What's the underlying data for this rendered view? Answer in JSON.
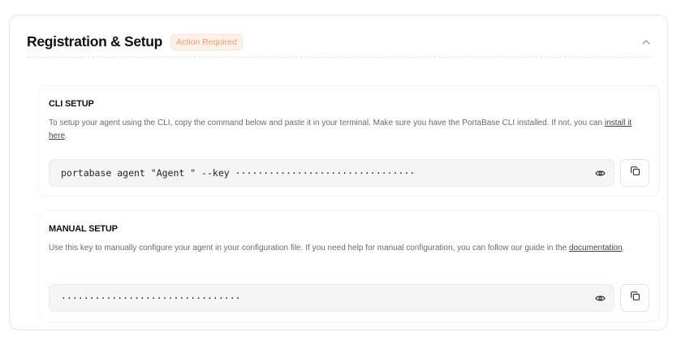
{
  "header": {
    "title": "Registration & Setup",
    "badge": "Action Required"
  },
  "cli": {
    "title": "CLI SETUP",
    "desc_before": "To setup your agent using the CLI, copy the command below and paste it in your terminal. Make sure you have the PortaBase CLI installed. If not, you can ",
    "link": "install it here",
    "desc_after": ".",
    "command": "portabase agent \"Agent \" --key ································"
  },
  "manual": {
    "title": "MANUAL SETUP",
    "desc_before": "Use this key to manually configure your agent in your configuration file. If you need help for manual configuration, you can follow our guide in the ",
    "link": "documentation",
    "desc_after": ".",
    "key": "································"
  },
  "icons": {
    "collapse": "chevron-up-icon",
    "reveal": "eye-icon",
    "copy": "copy-icon"
  },
  "colors": {
    "badge_text": "#f59a6c",
    "badge_bg": "#fdf1ea",
    "field_bg": "#f5f5f5"
  }
}
